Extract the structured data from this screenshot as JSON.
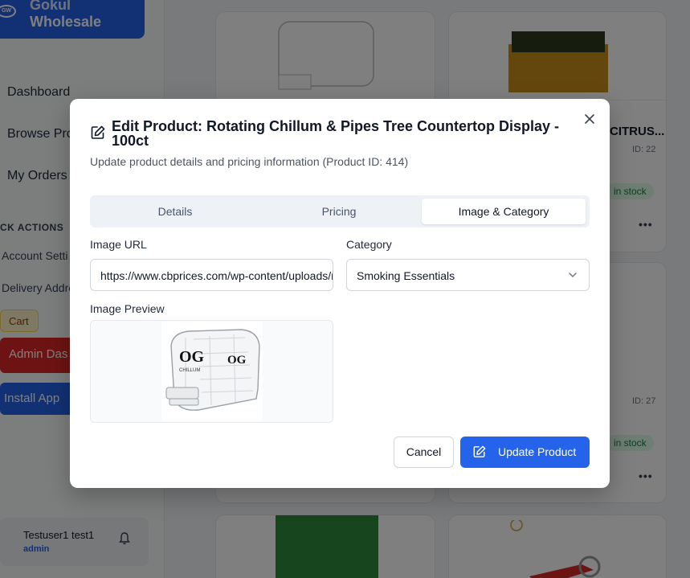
{
  "app": {
    "brand_line1": "Gokul",
    "brand_line2": "Wholesale",
    "logo_text": "GW"
  },
  "sidebar": {
    "items": [
      {
        "label": "Dashboard"
      },
      {
        "label": "Browse Pro"
      },
      {
        "label": "My Orders"
      }
    ],
    "quick_actions_title": "CK ACTIONS",
    "quick_actions": [
      {
        "label": "Account Setti"
      },
      {
        "label": "Delivery Addre"
      }
    ],
    "cart_label": "Cart",
    "admin_label": "Admin Das",
    "install_label": "Install App",
    "user_name": "Testuser1 test1",
    "user_role": "admin"
  },
  "background_products": [
    {
      "title": "CITRUS...",
      "id": "ID: 22",
      "stock": "in stock"
    },
    {
      "id": "ID: 27",
      "stock": "in stock"
    }
  ],
  "modal": {
    "title": "Edit Product: Rotating Chillum & Pipes Tree Countertop Display - 100ct",
    "subtitle": "Update product details and pricing information (Product ID: 414)",
    "tabs": [
      {
        "label": "Details"
      },
      {
        "label": "Pricing"
      },
      {
        "label": "Image & Category"
      }
    ],
    "active_tab": "Image & Category",
    "image_url_label": "Image URL",
    "image_url_value": "https://www.cbprices.com/wp-content/uploads/rotating-chillum-pipes-tree.jpg",
    "category_label": "Category",
    "category_value": "Smoking Essentials",
    "image_preview_label": "Image Preview",
    "preview_logo_text": "OG",
    "cancel_label": "Cancel",
    "update_label": "Update Product"
  },
  "colors": {
    "primary": "#2563eb",
    "danger": "#dc2626",
    "success_bg": "#dcfce7",
    "success_text": "#15803d"
  }
}
